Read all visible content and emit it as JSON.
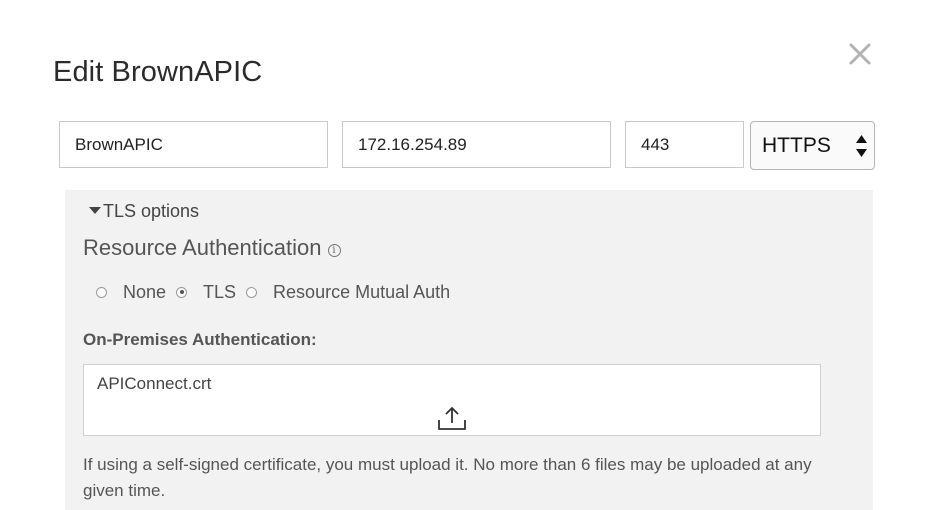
{
  "dialog": {
    "title": "Edit BrownAPIC",
    "close_icon": "close-icon"
  },
  "connection": {
    "name_value": "BrownAPIC",
    "host_value": "172.16.254.89",
    "port_value": "443",
    "protocol": {
      "selected": "HTTPS",
      "icon": "select-arrows-icon"
    }
  },
  "tls": {
    "toggle_label": "TLS options",
    "toggle_icon": "triangle-down-icon",
    "resource_auth_title": "Resource Authentication",
    "info_icon": "info-icon",
    "radio_options": [
      {
        "label": "None",
        "checked": false
      },
      {
        "label": "TLS",
        "checked": true
      },
      {
        "label": "Resource Mutual Auth",
        "checked": false
      }
    ],
    "onprem_label": "On-Premises Authentication:",
    "uploaded_file": "APIConnect.crt",
    "upload_icon": "upload-icon",
    "note": "If using a self-signed certificate, you must upload it. No more than 6 files may be uploaded at any given time."
  },
  "colors": {
    "panel_bg": "#f2f2f2",
    "text": "#555555",
    "close": "#b3b3b3"
  }
}
